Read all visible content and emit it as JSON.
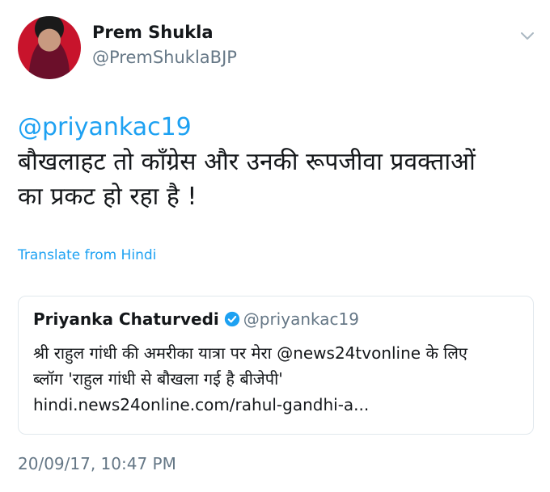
{
  "author": {
    "name": "Prem Shukla",
    "handle": "@PremShuklaBJP"
  },
  "tweet": {
    "mention": "@priyankac19",
    "line1": "बौखलाहट तो कॉंग्रेस और उनकी रूपजीवा प्रवक्ताओं",
    "line2": "का प्रकट हो रहा है !"
  },
  "translate_label": "Translate from Hindi",
  "quoted_tweet": {
    "name": "Priyanka Chaturvedi",
    "handle": "@priyankac19",
    "line1": "श्री राहुल गांधी की अमरीका यात्रा पर मेरा @news24tvonline के लिए",
    "line2": "ब्लॉग 'राहुल गांधी से बौखला गई है बीजेपी'",
    "line3": "hindi.news24online.com/rahul-gandhi-a..."
  },
  "timestamp": "20/09/17, 10:47 PM",
  "colors": {
    "link": "#1da1f2",
    "secondary_text": "#657786",
    "border": "#e1e8ed"
  },
  "icons": {
    "chevron": "chevron-down-icon",
    "verified": "verified-badge-icon"
  }
}
